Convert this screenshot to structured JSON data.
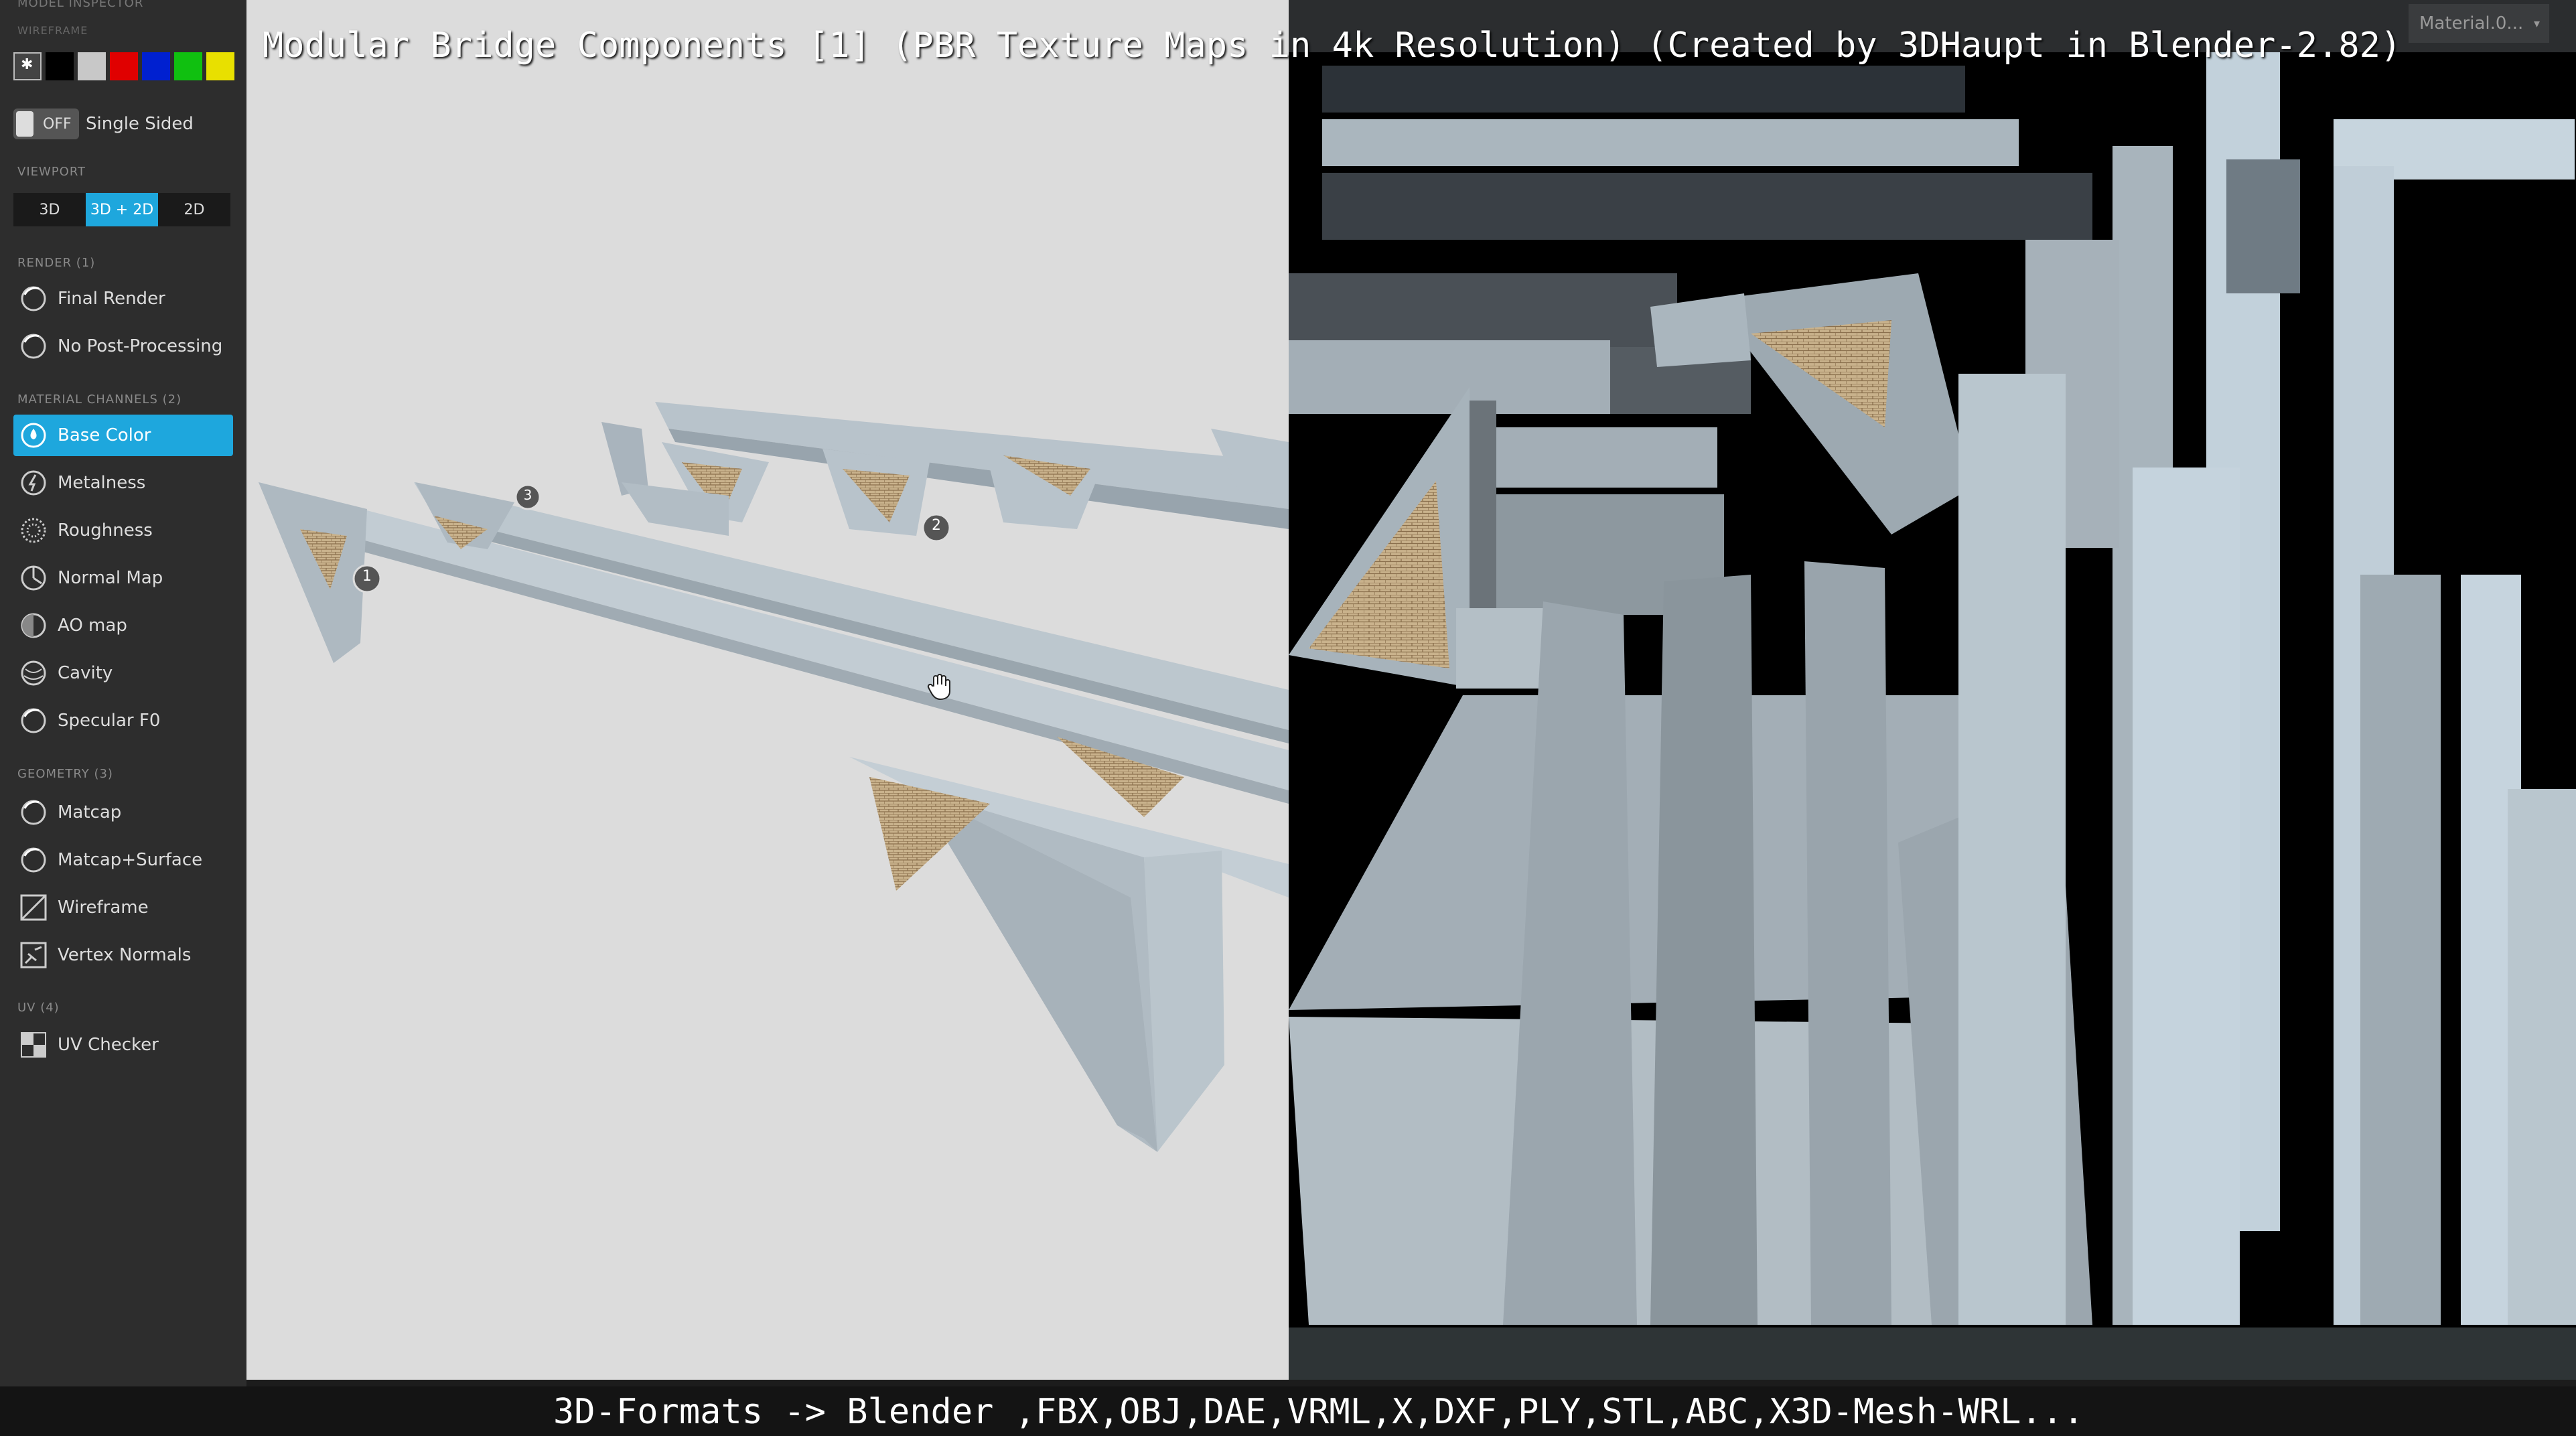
{
  "title": "Modular Bridge Components [1] (PBR Texture Maps in 4k Resolution) (Created by 3DHaupt in Blender-2.82)",
  "footer": "3D-Formats -> Blender ,FBX,OBJ,DAE,VRML,X,DXF,PLY,STL,ABC,X3D-Mesh-WRL...",
  "sidebar": {
    "header": "Model Inspector",
    "wireframe_label": "WIREFRAME",
    "swatch_colors": [
      "#000000",
      "#c8c8c8",
      "#e00000",
      "#0020d0",
      "#10c010",
      "#e8e000"
    ],
    "toggle": {
      "state": "OFF",
      "label": "Single Sided"
    },
    "viewport_label": "VIEWPORT",
    "viewport_buttons": [
      "3D",
      "3D + 2D",
      "2D"
    ],
    "render_label": "RENDER (1)",
    "render_items": [
      "Final Render",
      "No Post-Processing"
    ],
    "material_label": "MATERIAL CHANNELS (2)",
    "material_items": [
      "Base Color",
      "Metalness",
      "Roughness",
      "Normal Map",
      "AO map",
      "Cavity",
      "Specular F0"
    ],
    "geometry_label": "GEOMETRY (3)",
    "geometry_items": [
      "Matcap",
      "Matcap+Surface",
      "Wireframe",
      "Vertex Normals"
    ],
    "uv_label": "UV (4)",
    "uv_items": [
      "UV Checker"
    ]
  },
  "uv_panel": {
    "material_select": "Material.0..."
  },
  "markers": [
    "1",
    "2",
    "3"
  ],
  "colors": {
    "accent": "#1ea7dd",
    "concrete": "#b9c4cc",
    "uv_bg": "#000000"
  }
}
